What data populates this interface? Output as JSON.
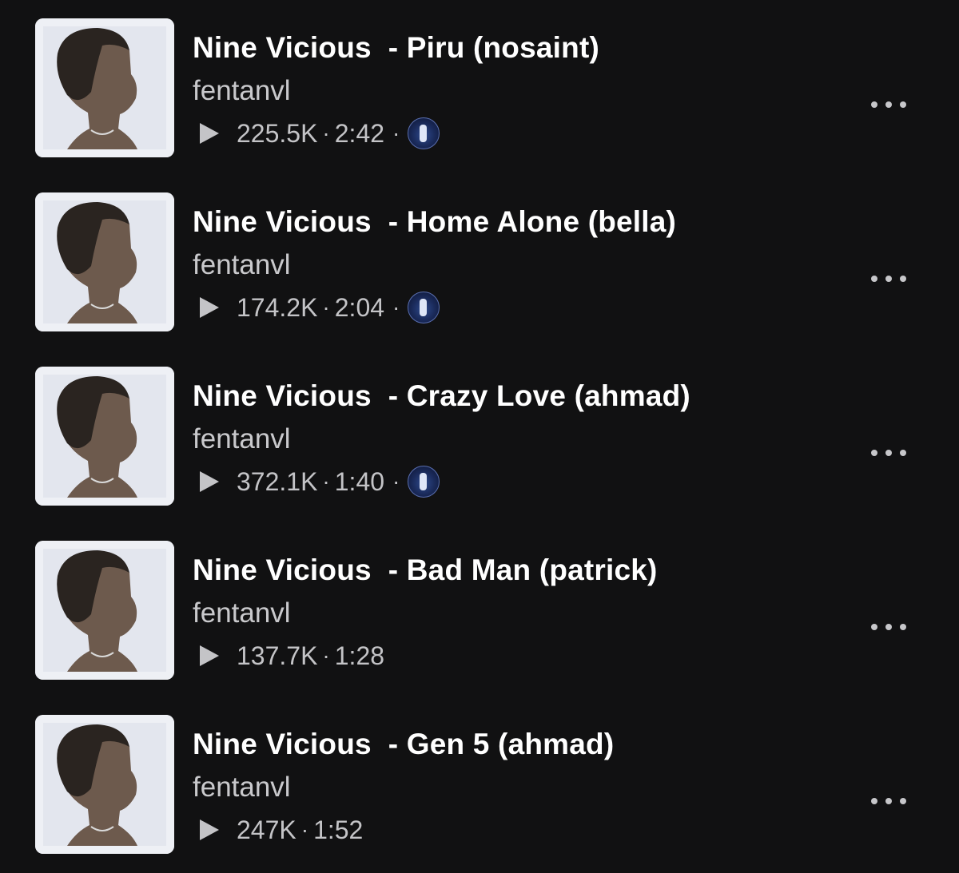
{
  "tracks": [
    {
      "title": "Nine Vicious  - Piru (nosaint)",
      "uploader": "fentanvl",
      "plays": "225.5K",
      "duration": "2:42",
      "has_repost_avatar": true
    },
    {
      "title": "Nine Vicious  - Home Alone (bella)",
      "uploader": "fentanvl",
      "plays": "174.2K",
      "duration": "2:04",
      "has_repost_avatar": true
    },
    {
      "title": "Nine Vicious  - Crazy Love (ahmad)",
      "uploader": "fentanvl",
      "plays": "372.1K",
      "duration": "1:40",
      "has_repost_avatar": true
    },
    {
      "title": "Nine Vicious  - Bad Man (patrick)",
      "uploader": "fentanvl",
      "plays": "137.7K",
      "duration": "1:28",
      "has_repost_avatar": false
    },
    {
      "title": "Nine Vicious  - Gen 5 (ahmad)",
      "uploader": "fentanvl",
      "plays": "247K",
      "duration": "1:52",
      "has_repost_avatar": false
    }
  ],
  "separator": "·",
  "icons": {
    "play": "play-icon",
    "more": "more-options-icon",
    "artwork": "album-artwork",
    "repost_avatar": "repost-avatar"
  },
  "colors": {
    "background": "#111112",
    "title": "#ffffff",
    "subtext": "#c9c9cc",
    "artwork_background": "#f4f5f8"
  }
}
